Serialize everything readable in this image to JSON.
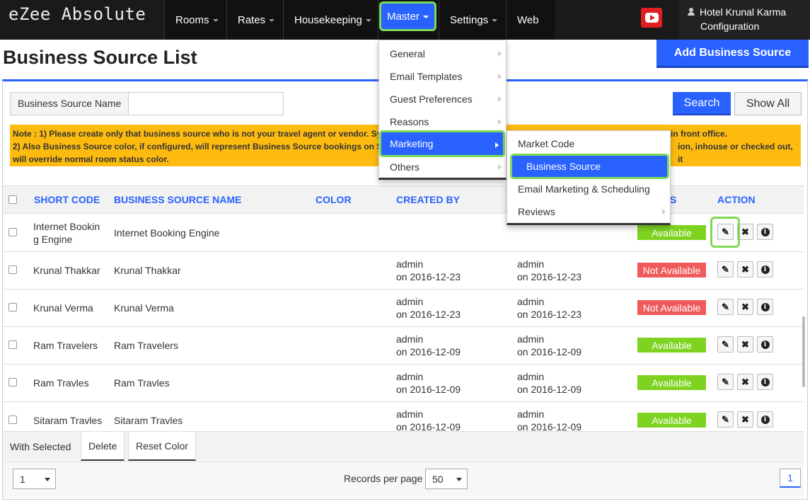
{
  "brand": "eZee Absolute",
  "nav": {
    "rooms": "Rooms",
    "rates": "Rates",
    "housekeeping": "Housekeeping",
    "master": "Master",
    "settings": "Settings",
    "web": "Web",
    "user_line1": "Hotel Krunal Karma",
    "user_line2": "Configuration"
  },
  "page": {
    "title": "Business Source List",
    "add_button": "Add Business Source"
  },
  "search": {
    "label": "Business Source Name",
    "value": "",
    "search_button": "Search",
    "show_all_button": "Show All"
  },
  "note": {
    "line1_left": "Note : 1) Please create only that business source who is not your travel agent or vendor. Sy",
    "line1_right": "in front office.",
    "line2_left": "2) Also Business Source color, if configured, will represent Business Source bookings on S",
    "line2_right": "ion, inhouse or checked out, it",
    "line3": "will override normal room status color."
  },
  "table": {
    "headers": {
      "short_code": "SHORT CODE",
      "name": "BUSINESS SOURCE NAME",
      "color": "COLOR",
      "created_by": "CREATED BY",
      "status": "S",
      "action": "ACTION"
    },
    "rows": [
      {
        "short_code_1": "Internet Bookin",
        "short_code_2": "g Engine",
        "name": "Internet Booking Engine",
        "created_by_1": "",
        "created_by_2": "",
        "updated_by_1": "",
        "updated_by_2": "",
        "status": "Available",
        "status_color": "#7ed321"
      },
      {
        "short_code_1": "Krunal Thakkar",
        "short_code_2": "",
        "name": "Krunal Thakkar",
        "created_by_1": "admin",
        "created_by_2": "on 2016-12-23",
        "updated_by_1": "admin",
        "updated_by_2": "on 2016-12-23",
        "status": "Not Available",
        "status_color": "#f05a5a"
      },
      {
        "short_code_1": "Krunal Verma",
        "short_code_2": "",
        "name": "Krunal Verma",
        "created_by_1": "admin",
        "created_by_2": "on 2016-12-23",
        "updated_by_1": "admin",
        "updated_by_2": "on 2016-12-23",
        "status": "Not Available",
        "status_color": "#f05a5a"
      },
      {
        "short_code_1": "Ram Travelers",
        "short_code_2": "",
        "name": "Ram Travelers",
        "created_by_1": "admin",
        "created_by_2": "on 2016-12-09",
        "updated_by_1": "admin",
        "updated_by_2": "on 2016-12-09",
        "status": "Available",
        "status_color": "#7ed321"
      },
      {
        "short_code_1": "Ram Travles",
        "short_code_2": "",
        "name": "Ram Travles",
        "created_by_1": "admin",
        "created_by_2": "on 2016-12-09",
        "updated_by_1": "admin",
        "updated_by_2": "on 2016-12-09",
        "status": "Available",
        "status_color": "#7ed321"
      },
      {
        "short_code_1": "Sitaram Travles",
        "short_code_2": "",
        "name": "Sitaram Travles",
        "created_by_1": "admin",
        "created_by_2": "on 2016-12-09",
        "updated_by_1": "admin",
        "updated_by_2": "on 2016-12-09",
        "status": "Available",
        "status_color": "#7ed321"
      }
    ]
  },
  "bulk": {
    "with_selected": "With Selected",
    "delete": "Delete",
    "reset_color": "Reset Color"
  },
  "footer": {
    "page_select": "1",
    "records_label": "Records per page",
    "records_value": "50",
    "current_page": "1"
  },
  "master_menu": {
    "items": [
      "General",
      "Email Templates",
      "Guest Preferences",
      "Reasons",
      "Marketing",
      "Others"
    ]
  },
  "marketing_submenu": {
    "items": [
      "Market Code",
      "Business Source",
      "Email Marketing & Scheduling",
      "Reviews"
    ]
  },
  "icons": {
    "edit": "pencil-icon",
    "delete": "close-icon",
    "info": "info-icon",
    "youtube": "youtube-icon",
    "user": "user-icon"
  },
  "colors": {
    "accent": "#2962ff",
    "highlight": "#7ed957",
    "available": "#7ed321",
    "not_available": "#f05a5a",
    "note_bg": "#fdbb10"
  }
}
